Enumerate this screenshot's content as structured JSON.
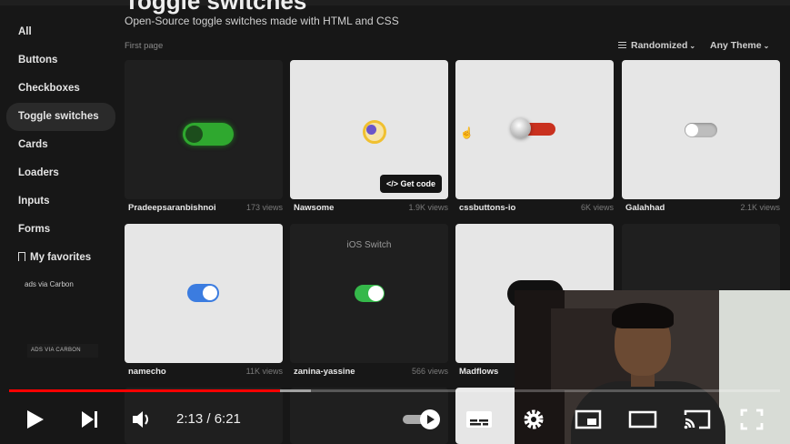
{
  "header": {
    "title": "Toggle switches",
    "subtitle": "Open-Source toggle switches made with HTML and CSS"
  },
  "sidebar": {
    "items": [
      {
        "label": "All"
      },
      {
        "label": "Buttons"
      },
      {
        "label": "Checkboxes"
      },
      {
        "label": "Toggle switches",
        "active": true
      },
      {
        "label": "Cards"
      },
      {
        "label": "Loaders"
      },
      {
        "label": "Inputs"
      },
      {
        "label": "Forms"
      },
      {
        "label": "My favorites"
      }
    ],
    "ad_image_alt": "ads via Carbon",
    "ad_label": "ADS VIA CARBON"
  },
  "listing": {
    "page_label": "First page",
    "sort_label": "Randomized",
    "theme_label": "Any Theme",
    "get_code_label": "Get code"
  },
  "cards": [
    {
      "author": "Pradeepsaranbishnoi",
      "views": "173 views"
    },
    {
      "author": "Nawsome",
      "views": "1.9K views"
    },
    {
      "author": "cssbuttons-io",
      "views": "6K views"
    },
    {
      "author": "Galahhad",
      "views": "2.1K views"
    },
    {
      "author": "namecho",
      "views": "11K views"
    },
    {
      "author": "zanina-yassine",
      "views": "566 views",
      "inner_label": "iOS Switch"
    },
    {
      "author": "Madflows",
      "views": ""
    },
    {
      "author": "",
      "views": ""
    }
  ],
  "player": {
    "time": "2:13 / 6:21",
    "progress_fraction": 0.351,
    "buffer_fraction": 0.391,
    "colors": {
      "played": "#ff0000"
    }
  }
}
